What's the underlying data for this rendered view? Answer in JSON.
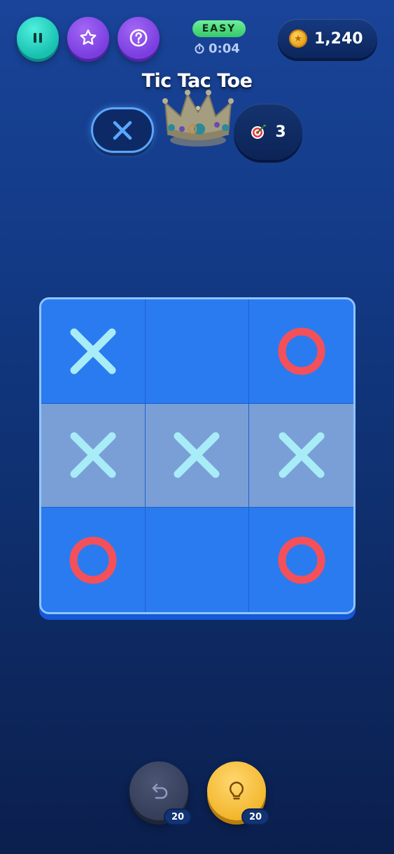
{
  "header": {
    "difficulty": "EASY",
    "timer": "0:04",
    "coins": "1,240"
  },
  "title": "Tic Tac Toe",
  "player": {
    "mark": "X"
  },
  "goal": {
    "value": "3"
  },
  "board": {
    "cells": [
      "X",
      "",
      "O",
      "X",
      "X",
      "X",
      "O",
      "",
      "O"
    ],
    "winning_row": 1
  },
  "colors": {
    "x_mark": "#a8ecf8",
    "o_mark": "#f4505a",
    "board": "#2a7bf0",
    "win_highlight": "#7a9fd6"
  },
  "powerups": {
    "undo": {
      "icon": "undo-icon",
      "count": "20"
    },
    "hint": {
      "icon": "lightbulb-icon",
      "count": "20"
    }
  }
}
